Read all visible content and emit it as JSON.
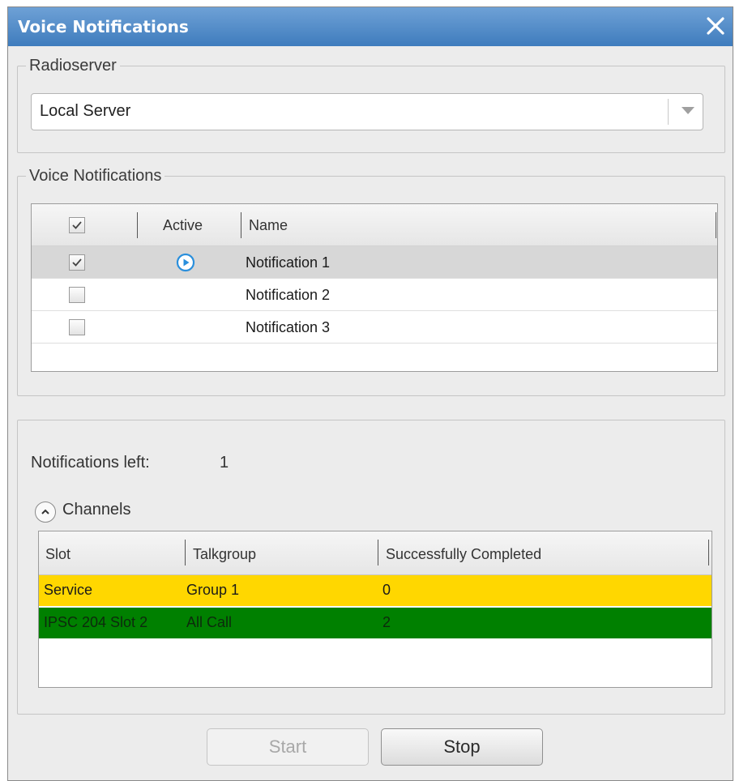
{
  "window": {
    "title": "Voice Notifications"
  },
  "radioserver": {
    "label": "Radioserver",
    "selected": "Local Server"
  },
  "voice_notifications": {
    "label": "Voice Notifications",
    "columns": {
      "active": "Active",
      "name": "Name"
    },
    "rows": [
      {
        "checked": true,
        "active": true,
        "name": "Notification 1"
      },
      {
        "checked": false,
        "active": false,
        "name": "Notification 2"
      },
      {
        "checked": false,
        "active": false,
        "name": "Notification 3"
      }
    ]
  },
  "status": {
    "notifications_left_label": "Notifications left:",
    "notifications_left_value": "1"
  },
  "channels": {
    "label": "Channels",
    "columns": {
      "slot": "Slot",
      "talkgroup": "Talkgroup",
      "completed": "Successfully Completed"
    },
    "rows": [
      {
        "slot": "Service",
        "talkgroup": "Group 1",
        "completed": "0",
        "color": "#ffd700",
        "text_color": "#1a1a1a"
      },
      {
        "slot": "IPSC 204 Slot 2",
        "talkgroup": "All Call",
        "completed": "2",
        "color": "#008000",
        "text_color": "#0d2a0d"
      }
    ]
  },
  "buttons": {
    "start": "Start",
    "stop": "Stop"
  },
  "colors": {
    "title_bar": "#4a86c5",
    "accent_icon": "#2a8fdc",
    "service_row": "#ffd700",
    "ipsc_row": "#008000"
  }
}
